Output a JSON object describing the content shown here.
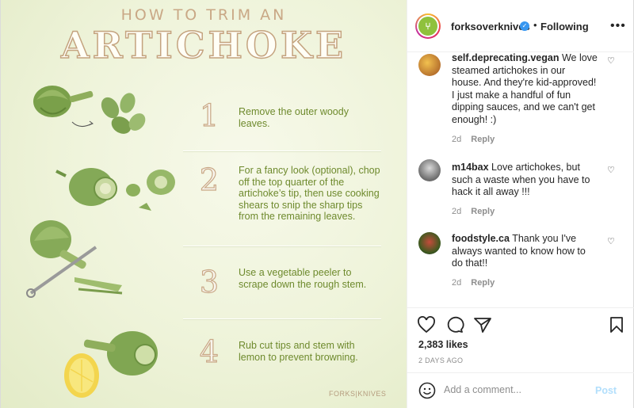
{
  "infographic": {
    "title_top": "HOW TO TRIM AN",
    "title_big": "ARTICHOKE",
    "steps": [
      {
        "num": "1",
        "text": "Remove the outer woody leaves."
      },
      {
        "num": "2",
        "text": "For a fancy look (optional), chop off the top quarter of the artichoke’s tip, then use cooking shears to snip the sharp tips from the remaining leaves."
      },
      {
        "num": "3",
        "text": "Use a vegetable peeler to scrape down the rough stem."
      },
      {
        "num": "4",
        "text": "Rub cut tips and stem with lemon to prevent browning."
      }
    ],
    "brand": "FORKS|KNIVES"
  },
  "header": {
    "username": "forksoverknives",
    "verified_icon": "verified-badge-icon",
    "separator": "•",
    "follow_status": "Following",
    "more_icon": "more-options-icon",
    "more_label": "•••"
  },
  "comments": [
    {
      "user": "self.deprecating.vegan",
      "text": "We love steamed artichokes in our house. And they're kid-approved! I just make a handful of fun dipping sauces, and we can't get enough! :)",
      "age": "2d",
      "reply": "Reply"
    },
    {
      "user": "m14bax",
      "text": "Love artichokes, but such a waste when you have to hack it all away !!!",
      "age": "2d",
      "reply": "Reply"
    },
    {
      "user": "foodstyle.ca",
      "text": "Thank you I've always wanted to know how to do that!!",
      "age": "2d",
      "reply": "Reply"
    }
  ],
  "post": {
    "likes": "2,383 likes",
    "date": "2 DAYS AGO"
  },
  "add_comment": {
    "placeholder": "Add a comment...",
    "post_label": "Post"
  },
  "colors": {
    "verified": "#3897f0",
    "step_text": "#6e8a2d",
    "post_button_disabled": "#b2dffc"
  }
}
